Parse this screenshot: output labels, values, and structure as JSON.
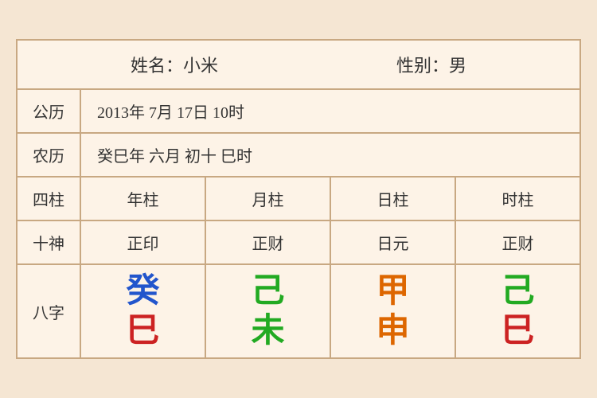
{
  "header": {
    "name_label": "姓名：小米",
    "gender_label": "性别：男"
  },
  "solar": {
    "label": "公历",
    "value": "2013年 7月 17日 10时"
  },
  "lunar": {
    "label": "农历",
    "value": "癸巳年 六月 初十 巳时"
  },
  "sizhu": {
    "label": "四柱",
    "columns": [
      "年柱",
      "月柱",
      "日柱",
      "时柱"
    ]
  },
  "shishen": {
    "label": "十神",
    "columns": [
      "正印",
      "正财",
      "日元",
      "正财"
    ]
  },
  "bazi": {
    "label": "八字",
    "columns": [
      {
        "top": "癸",
        "top_color": "color-blue",
        "bottom": "巳",
        "bottom_color": "color-red"
      },
      {
        "top": "己",
        "top_color": "color-green",
        "bottom": "未",
        "bottom_color": "color-green"
      },
      {
        "top": "甲",
        "top_color": "color-orange",
        "bottom": "申",
        "bottom_color": "color-orange"
      },
      {
        "top": "己",
        "top_color": "color-green",
        "bottom": "巳",
        "bottom_color": "color-red"
      }
    ]
  }
}
